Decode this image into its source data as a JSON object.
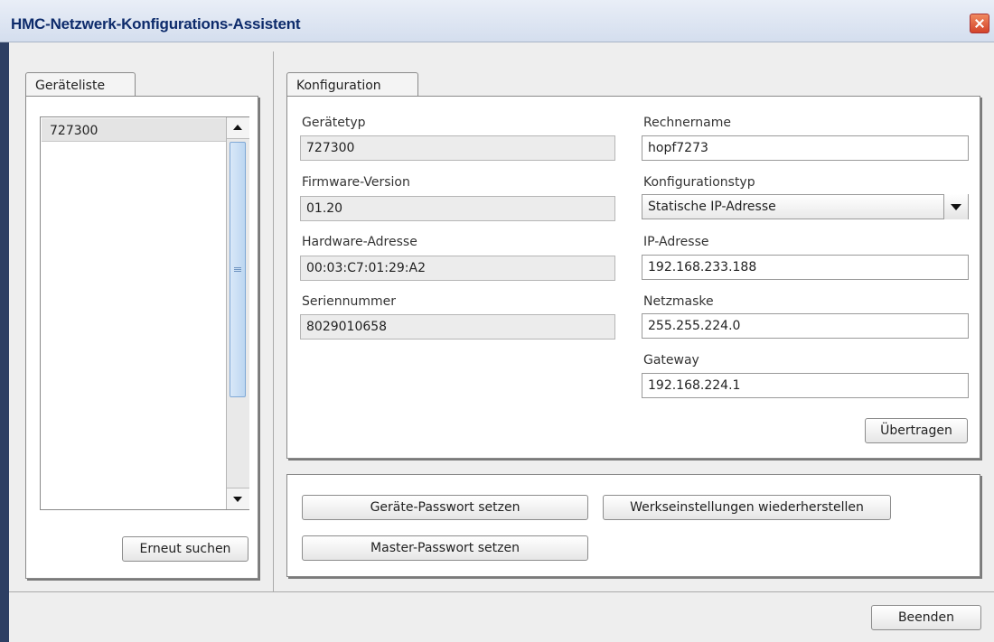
{
  "window": {
    "title": "HMC-Netzwerk-Konfigurations-Assistent"
  },
  "device_list": {
    "tab_label": "Geräteliste",
    "items": [
      "727300"
    ],
    "rescan_button": "Erneut suchen"
  },
  "config": {
    "tab_label": "Konfiguration",
    "device_type_label": "Gerätetyp",
    "device_type_value": "727300",
    "firmware_label": "Firmware-Version",
    "firmware_value": "01.20",
    "hw_address_label": "Hardware-Adresse",
    "hw_address_value": "00:03:C7:01:29:A2",
    "serial_label": "Seriennummer",
    "serial_value": "8029010658",
    "hostname_label": "Rechnername",
    "hostname_value": "hopf7273",
    "config_type_label": "Konfigurationstyp",
    "config_type_value": "Statische IP-Adresse",
    "ip_label": "IP-Adresse",
    "ip_value": "192.168.233.188",
    "netmask_label": "Netzmaske",
    "netmask_value": "255.255.224.0",
    "gateway_label": "Gateway",
    "gateway_value": "192.168.224.1",
    "apply_button": "Übertragen"
  },
  "actions": {
    "device_password_button": "Geräte-Passwort setzen",
    "factory_reset_button": "Werkseinstellungen wiederherstellen",
    "master_password_button": "Master-Passwort setzen"
  },
  "footer": {
    "exit_button": "Beenden"
  }
}
